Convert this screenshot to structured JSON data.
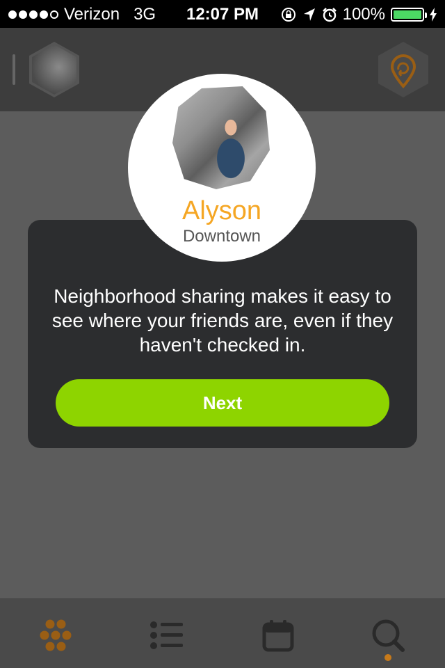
{
  "status_bar": {
    "carrier": "Verizon",
    "network": "3G",
    "time": "12:07 PM",
    "battery": "100%",
    "signal_bars_filled": 4,
    "signal_bars_total": 5
  },
  "top_bar": {
    "left_icon": "user-avatar-hex",
    "right_icon": "location-pin-icon"
  },
  "profile": {
    "name": "Alyson",
    "location": "Downtown"
  },
  "card": {
    "message": "Neighborhood sharing makes it easy to see where your friends are, even if they haven't checked in.",
    "button_label": "Next"
  },
  "tabs": [
    {
      "icon": "hexagon-cluster-icon",
      "active": true
    },
    {
      "icon": "list-icon",
      "active": false
    },
    {
      "icon": "calendar-icon",
      "active": false
    },
    {
      "icon": "search-icon",
      "active": false
    }
  ],
  "colors": {
    "accent_orange": "#f5a623",
    "button_green": "#8ed400",
    "tab_orange": "#c77a1a",
    "card_bg": "#2c2d2f",
    "battery_green": "#4cd964"
  }
}
